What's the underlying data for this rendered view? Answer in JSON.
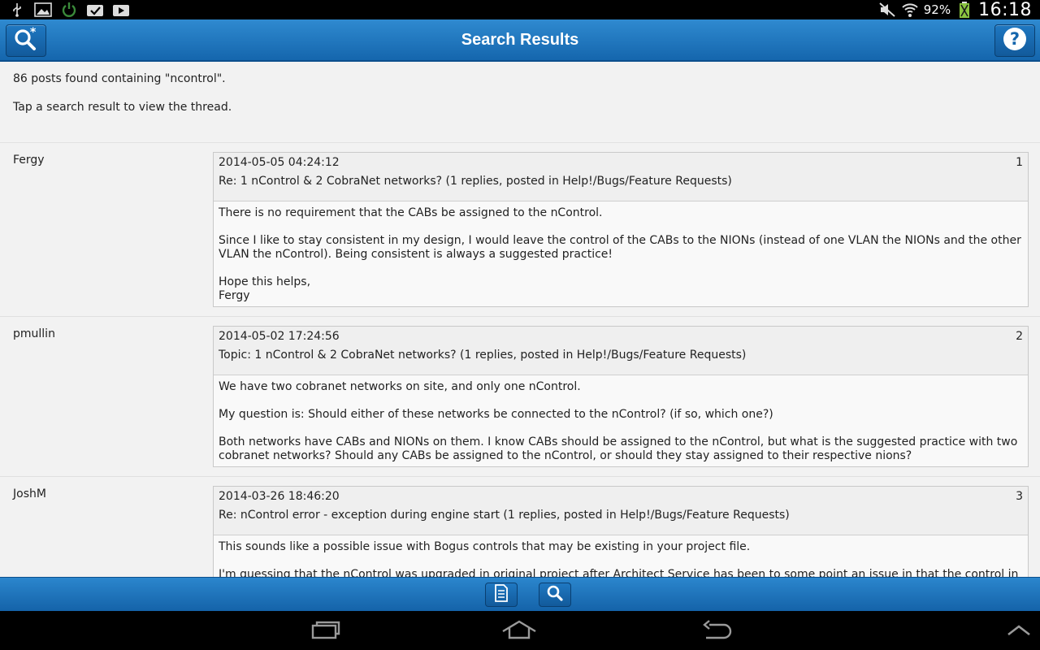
{
  "status_bar": {
    "icons_left": [
      "usb-icon",
      "image-icon",
      "power-icon",
      "task-check-icon",
      "play-store-icon"
    ],
    "icons_right": [
      "mute-icon",
      "wifi-icon",
      "battery-icon"
    ],
    "battery": "92%",
    "time": "16:18"
  },
  "header": {
    "title": "Search Results",
    "left_icon": "search-star-icon",
    "right_icon": "help-icon"
  },
  "intro": {
    "count_text": "86 posts found containing \"ncontrol\".",
    "hint_text": "Tap a search result to view the thread."
  },
  "results": [
    {
      "author": "Fergy",
      "date": "2014-05-05 04:24:12",
      "number": "1",
      "subject": "Re: 1 nControl & 2 CobraNet networks? (1 replies, posted in Help!/Bugs/Feature Requests)",
      "paragraphs": [
        "There is no requirement that the CABs be assigned to the nControl.",
        "Since I like to stay consistent in my design, I would leave the control of the CABs to the NIONs (instead of one VLAN the NIONs and the other VLAN the nControl). Being consistent is always a suggested practice!",
        "Hope this helps,\nFergy"
      ]
    },
    {
      "author": "pmullin",
      "date": "2014-05-02 17:24:56",
      "number": "2",
      "subject": "Topic: 1 nControl & 2 CobraNet networks? (1 replies, posted in Help!/Bugs/Feature Requests)",
      "paragraphs": [
        "We have two cobranet networks on site, and only one nControl.",
        "My question is: Should either of these networks be connected to the nControl? (if so, which one?)",
        "Both networks have CABs and NIONs on them. I know CABs should be assigned to the nControl, but what is the suggested practice with two cobranet networks? Should any CABs be assigned to the nControl, or should they stay assigned to their respective nions?"
      ]
    },
    {
      "author": "JoshM",
      "date": "2014-03-26 18:46:20",
      "number": "3",
      "subject": "Re: nControl error - exception during engine start (1 replies, posted in Help!/Bugs/Feature Requests)",
      "paragraphs": [
        "This sounds like a possible issue with Bogus controls that may be existing in your project file.",
        "I'm guessing that the nControl was upgraded in original project after Architect Service has been to some point an issue in that the control in the project file."
      ]
    }
  ],
  "bottom_toolbar": {
    "buttons": [
      "thread-list-icon",
      "search-icon"
    ]
  },
  "nav_bar": {
    "buttons": [
      "recent-apps-icon",
      "home-icon",
      "back-icon",
      "collapse-icon"
    ]
  },
  "colors": {
    "accent": "#1e74bd",
    "background": "#f2f2f2"
  }
}
